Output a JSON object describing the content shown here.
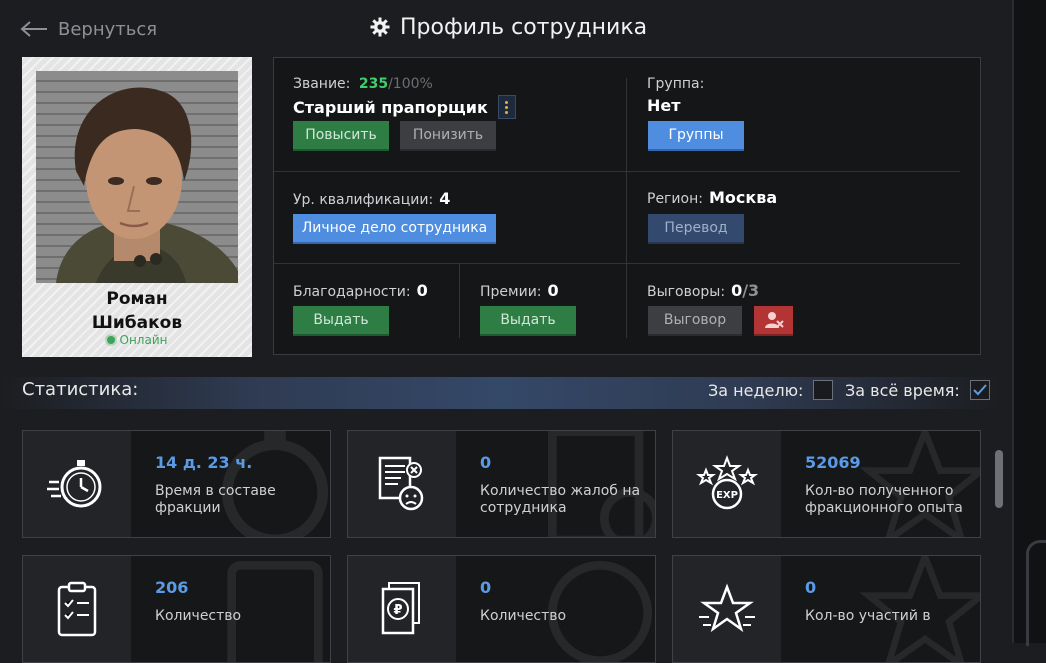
{
  "header": {
    "back_label": "Вернуться",
    "title": "Профиль сотрудника"
  },
  "employee": {
    "first_name": "Роман",
    "last_name": "Шибаков",
    "status": "Онлайн"
  },
  "rank": {
    "label": "Звание:",
    "progress": "235",
    "progress_max": "/100%",
    "value": "Старший прапорщик",
    "promote_label": "Повысить",
    "demote_label": "Понизить"
  },
  "group": {
    "label": "Группа:",
    "value": "Нет",
    "button_label": "Группы"
  },
  "qualification": {
    "label": "Ур. квалификации:",
    "value": "4",
    "button_label": "Личное дело сотрудника"
  },
  "region": {
    "label": "Регион:",
    "value": "Москва",
    "button_label": "Перевод"
  },
  "thanks": {
    "label": "Благодарности:",
    "value": "0",
    "button_label": "Выдать"
  },
  "bonuses": {
    "label": "Премии:",
    "value": "0",
    "button_label": "Выдать"
  },
  "reprimands": {
    "label": "Выговоры:",
    "value": "0",
    "max": "/3",
    "button_label": "Выговор"
  },
  "stats": {
    "title": "Статистика:",
    "week_label": "За неделю:",
    "week_checked": false,
    "all_time_label": "За всё время:",
    "all_time_checked": true,
    "tiles": [
      {
        "icon": "stopwatch-icon",
        "value": "14 д. 23 ч.",
        "label": "Время в составе фракции"
      },
      {
        "icon": "complaint-document-icon",
        "value": "0",
        "label": "Количество жалоб на сотрудника"
      },
      {
        "icon": "exp-stars-icon",
        "value": "52069",
        "label": "Кол-во полученного фракционного опыта"
      },
      {
        "icon": "clipboard-checklist-icon",
        "value": "206",
        "label": "Количество"
      },
      {
        "icon": "ruble-document-icon",
        "value": "0",
        "label": "Количество"
      },
      {
        "icon": "star-icon",
        "value": "0",
        "label": "Кол-во участий в"
      }
    ]
  },
  "colors": {
    "accent_blue": "#4f8de0",
    "green": "#2e7d45",
    "red": "#b33434",
    "value_blue": "#5b9be6",
    "progress_green": "#3fcf6a"
  }
}
